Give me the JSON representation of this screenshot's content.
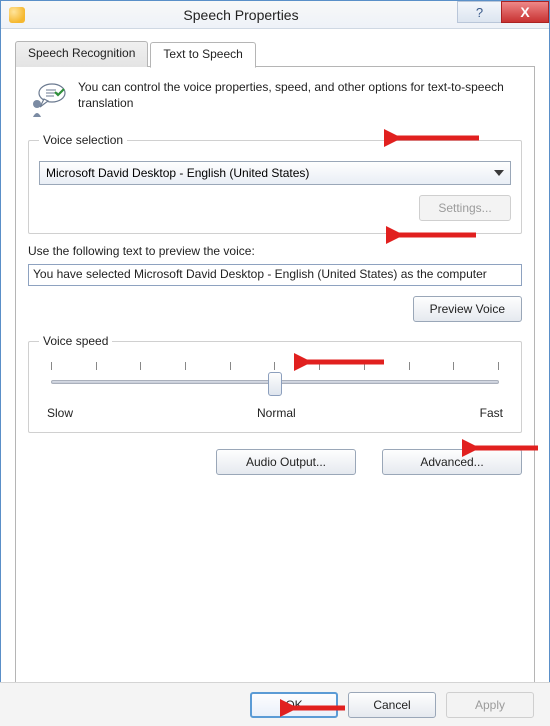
{
  "title": "Speech Properties",
  "titlebar": {
    "help_tooltip": "?",
    "close_tooltip": "X"
  },
  "tabs": {
    "speech_recognition": "Speech Recognition",
    "text_to_speech": "Text to Speech"
  },
  "intro": "You can control the voice properties, speed, and other options for text-to-speech translation",
  "voice_selection": {
    "legend": "Voice selection",
    "selected": "Microsoft David Desktop - English (United States)",
    "settings_button": "Settings..."
  },
  "preview": {
    "label": "Use the following text to preview the voice:",
    "text": "You have selected Microsoft David Desktop - English (United States) as the computer",
    "button": "Preview Voice"
  },
  "voice_speed": {
    "legend": "Voice speed",
    "slow": "Slow",
    "normal": "Normal",
    "fast": "Fast",
    "value_position_percent": 50
  },
  "buttons": {
    "audio_output": "Audio Output...",
    "advanced": "Advanced..."
  },
  "footer": {
    "ok": "OK",
    "cancel": "Cancel",
    "apply": "Apply"
  }
}
